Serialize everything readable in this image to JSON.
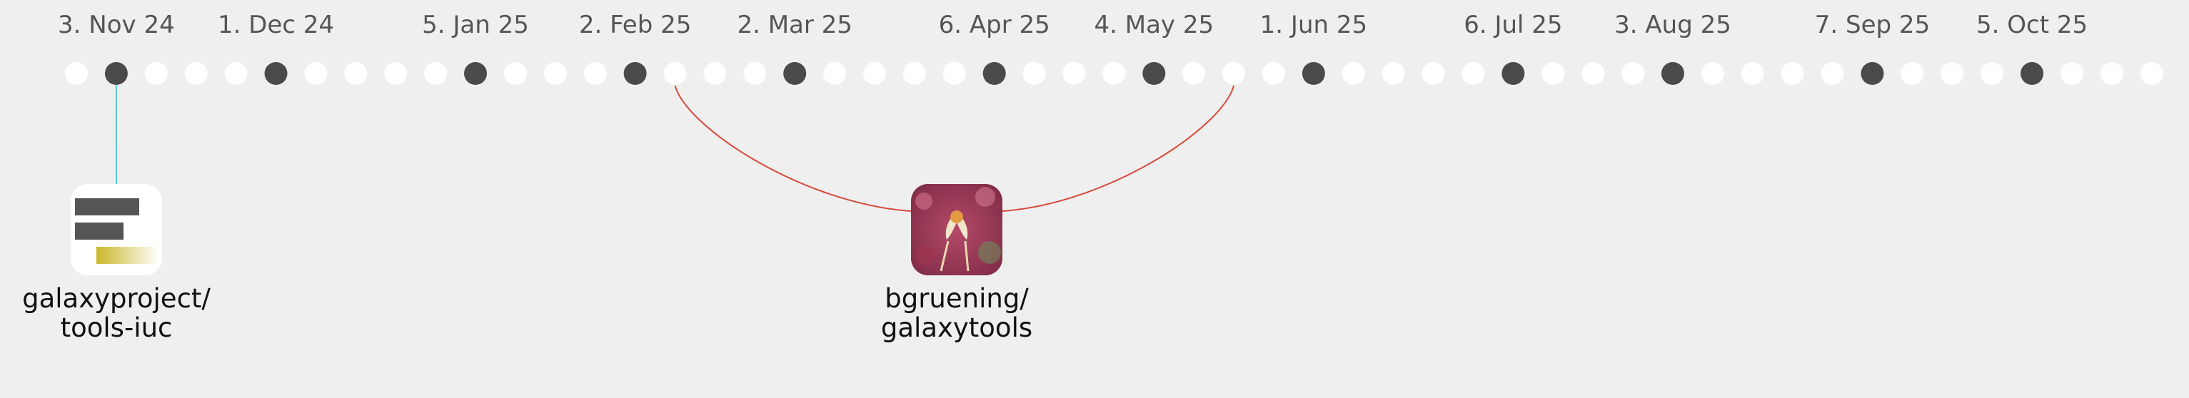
{
  "timeline": {
    "background": "#efefef",
    "dot_filled_color": "#4a4a4a",
    "dot_empty_color": "#ffffff",
    "total_dots": 53,
    "labeled_dots": [
      {
        "index": 1,
        "label": "3. Nov 24"
      },
      {
        "index": 5,
        "label": "1. Dec 24"
      },
      {
        "index": 10,
        "label": "5. Jan 25"
      },
      {
        "index": 14,
        "label": "2. Feb 25"
      },
      {
        "index": 18,
        "label": "2. Mar 25"
      },
      {
        "index": 23,
        "label": "6. Apr 25"
      },
      {
        "index": 27,
        "label": "4. May 25"
      },
      {
        "index": 31,
        "label": "1. Jun 25"
      },
      {
        "index": 36,
        "label": "6. Jul 25"
      },
      {
        "index": 40,
        "label": "3. Aug 25"
      },
      {
        "index": 45,
        "label": "7. Sep 25"
      },
      {
        "index": 49,
        "label": "5. Oct 25"
      }
    ]
  },
  "repos": [
    {
      "id": "tools-iuc",
      "name": "galaxyproject/\ntools-iuc",
      "icon": "galaxy-project-logo-icon",
      "link_color": "#5bc8d6",
      "connects_to_dots": [
        1
      ]
    },
    {
      "id": "galaxytools",
      "name": "bgruening/\ngalaxytools",
      "icon": "orchid-flower-avatar-icon",
      "link_color": "#d64a3c",
      "connects_to_dots": [
        15,
        29
      ]
    }
  ]
}
